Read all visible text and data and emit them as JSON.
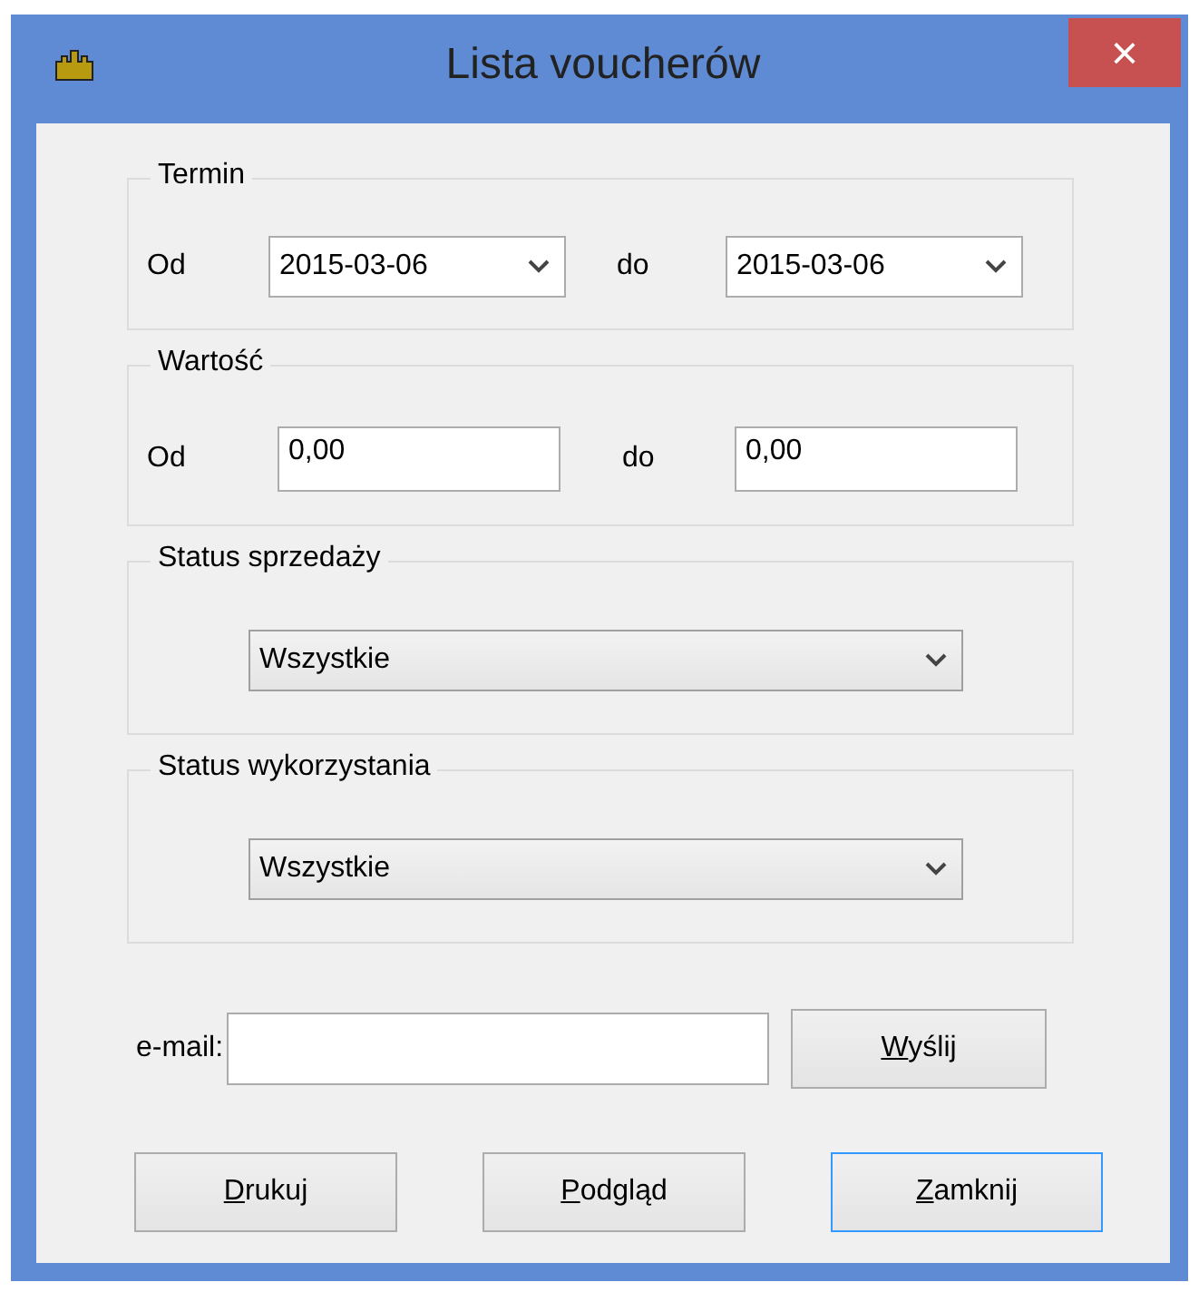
{
  "window": {
    "title": "Lista voucherów",
    "close": "×"
  },
  "termin": {
    "title": "Termin",
    "from_label": "Od",
    "from": "2015-03-06",
    "to_label": "do",
    "to": "2015-03-06"
  },
  "wartosc": {
    "title": "Wartość",
    "from_label": "Od",
    "from": "0,00",
    "to_label": "do",
    "to": "0,00"
  },
  "status_sprzedazy": {
    "title": "Status sprzedaży",
    "value": "Wszystkie"
  },
  "status_wykorzystania": {
    "title": "Status wykorzystania",
    "value": "Wszystkie"
  },
  "email": {
    "label": "e-mail:",
    "button": {
      "label": "Wyślij",
      "mnemonic": true,
      "focused": false
    }
  },
  "buttons": [
    {
      "label": "Drukuj",
      "mnemonic": true,
      "focused": false
    },
    {
      "label": "Podgląd",
      "mnemonic": true,
      "focused": false
    },
    {
      "label": "Zamknij",
      "mnemonic": true,
      "focused": true
    }
  ]
}
